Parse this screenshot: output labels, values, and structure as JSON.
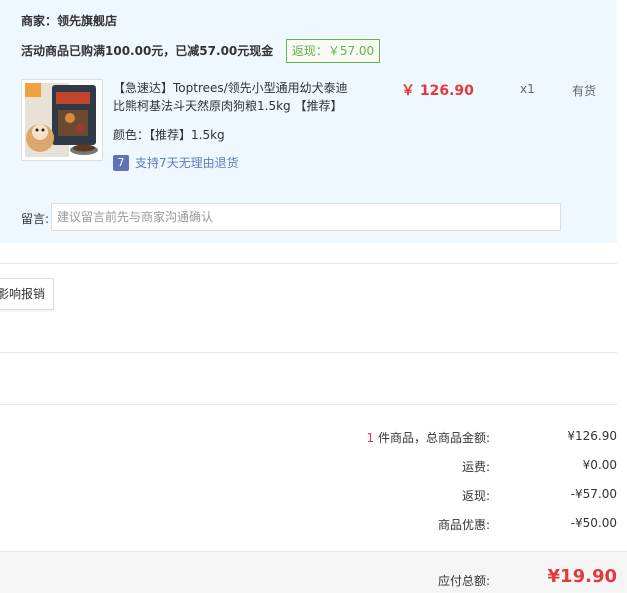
{
  "store": {
    "label": "商家：",
    "name": "领先旗舰店"
  },
  "promo": {
    "text": "活动商品已购满100.00元，已减57.00元现金",
    "rebate_badge": "返现：￥57.00"
  },
  "item": {
    "title": "【急速达】Toptrees/领先小型通用幼犬泰迪比熊柯基法斗天然原肉狗粮1.5kg 【推荐】",
    "spec": "颜色：【推荐】1.5kg",
    "return_policy": "支持7天无理由退货",
    "return_icon_glyph": "7",
    "price": "￥ 126.90",
    "quantity": "x1",
    "stock": "有货"
  },
  "remark": {
    "label": "留言:",
    "placeholder": "建议留言前先与商家沟通确认"
  },
  "invoice": {
    "button_label": "影响报销"
  },
  "summary": {
    "count": "1",
    "goods_label": " 件商品，总商品金额:",
    "goods_value": "¥126.90",
    "shipping_label": "运费:",
    "shipping_value": "¥0.00",
    "rebate_label": "返现:",
    "rebate_value": "-¥57.00",
    "discount_label": "商品优惠:",
    "discount_value": "-¥50.00",
    "total_label": "应付总额:",
    "total_value": "¥19.90"
  },
  "colors": {
    "price_red": "#e4393c",
    "rebate_green": "#6ab04c",
    "panel_bg": "#f0f8ff",
    "link_blue": "#5a7cc2"
  }
}
